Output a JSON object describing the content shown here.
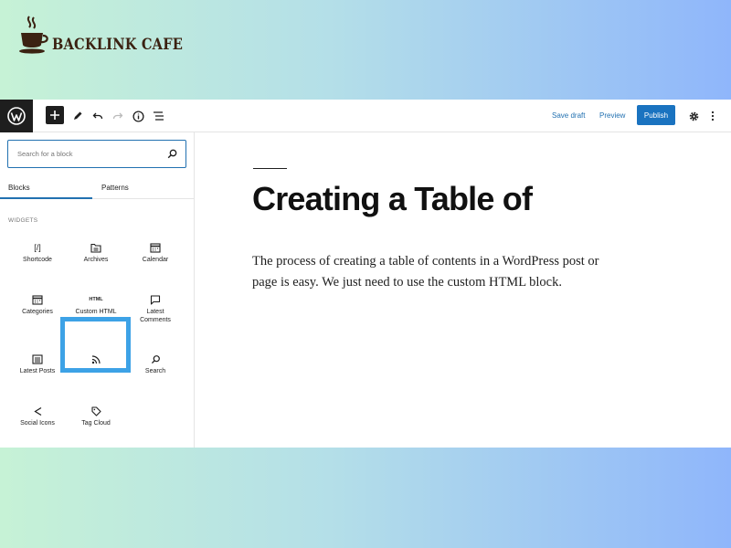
{
  "brand": {
    "name": "BACKLINK CAFE",
    "color": "#3b2212"
  },
  "toolbar": {
    "save_draft": "Save draft",
    "preview": "Preview",
    "publish": "Publish",
    "accent": "#1a73c0"
  },
  "inserter": {
    "search_placeholder": "Search for a block",
    "tabs": [
      "Blocks",
      "Patterns"
    ],
    "active_tab": "Blocks",
    "section": "WIDGETS",
    "blocks": [
      {
        "label": "Shortcode",
        "icon": "shortcode-icon",
        "glyph": "[/]"
      },
      {
        "label": "Archives",
        "icon": "archives-icon"
      },
      {
        "label": "Calendar",
        "icon": "calendar-icon"
      },
      {
        "label": "Categories",
        "icon": "categories-icon"
      },
      {
        "label": "Custom HTML",
        "icon": "html-icon",
        "glyph": "HTML",
        "highlighted": true
      },
      {
        "label": "Latest Comments",
        "icon": "comment-icon"
      },
      {
        "label": "Latest Posts",
        "icon": "posts-icon"
      },
      {
        "label": "RSS",
        "icon": "rss-icon"
      },
      {
        "label": "Search",
        "icon": "search-icon"
      },
      {
        "label": "Social Icons",
        "icon": "share-icon"
      },
      {
        "label": "Tag Cloud",
        "icon": "tag-icon"
      }
    ],
    "highlight_color": "#3da2e6"
  },
  "post": {
    "title": "Creating a Table of",
    "paragraph": "The process of creating a table of contents in a WordPress post or page is easy. We just need to use the custom HTML block."
  }
}
